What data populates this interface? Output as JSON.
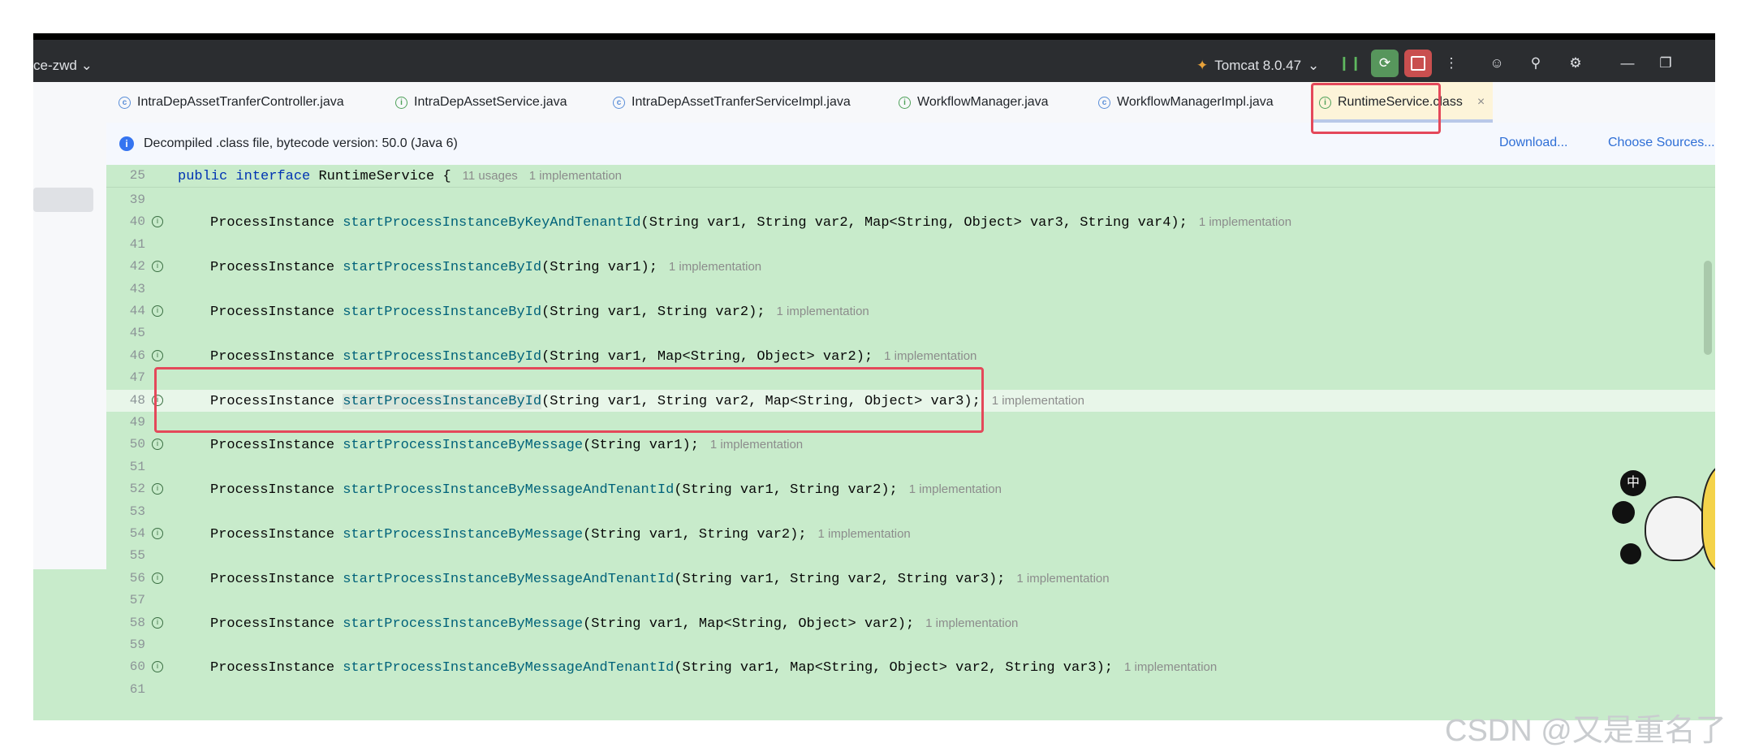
{
  "titlebar": {
    "project": "ce-zwd",
    "run_config": "Tomcat 8.0.47"
  },
  "tabs": [
    {
      "label": "IntraDepAssetTranferController.java",
      "icon": "class-icon"
    },
    {
      "label": "IntraDepAssetService.java",
      "icon": "interface-icon"
    },
    {
      "label": "IntraDepAssetTranferServiceImpl.java",
      "icon": "class-icon"
    },
    {
      "label": "WorkflowManager.java",
      "icon": "interface-icon"
    },
    {
      "label": "WorkflowManagerImpl.java",
      "icon": "class-icon"
    },
    {
      "label": "RuntimeService.class",
      "icon": "interface-icon",
      "active": true
    }
  ],
  "banner": {
    "text": "Decompiled .class file, bytecode version: 50.0 (Java 6)",
    "download": "Download...",
    "choose_sources": "Choose Sources..."
  },
  "sticky": {
    "line": "25",
    "code": "public interface RuntimeService {",
    "usages": "11 usages",
    "impl": "1 implementation"
  },
  "lines": [
    {
      "n": "39"
    },
    {
      "n": "40",
      "ret": "ProcessInstance",
      "method": "startProcessInstanceByKeyAndTenantId",
      "args": "(String var1, String var2, Map<String, Object> var3, String var4);",
      "hint": "1 implementation"
    },
    {
      "n": "41"
    },
    {
      "n": "42",
      "ret": "ProcessInstance",
      "method": "startProcessInstanceById",
      "args": "(String var1);",
      "hint": "1 implementation"
    },
    {
      "n": "43"
    },
    {
      "n": "44",
      "ret": "ProcessInstance",
      "method": "startProcessInstanceById",
      "args": "(String var1, String var2);",
      "hint": "1 implementation"
    },
    {
      "n": "45"
    },
    {
      "n": "46",
      "ret": "ProcessInstance",
      "method": "startProcessInstanceById",
      "args": "(String var1, Map<String, Object> var2);",
      "hint": "1 implementation"
    },
    {
      "n": "47"
    },
    {
      "n": "48",
      "ret": "ProcessInstance",
      "method": "startProcessInstanceById",
      "args": "(String var1, String var2, Map<String, Object> var3);",
      "hint": "1 implementation",
      "current": true
    },
    {
      "n": "49"
    },
    {
      "n": "50",
      "ret": "ProcessInstance",
      "method": "startProcessInstanceByMessage",
      "args": "(String var1);",
      "hint": "1 implementation"
    },
    {
      "n": "51"
    },
    {
      "n": "52",
      "ret": "ProcessInstance",
      "method": "startProcessInstanceByMessageAndTenantId",
      "args": "(String var1, String var2);",
      "hint": "1 implementation"
    },
    {
      "n": "53"
    },
    {
      "n": "54",
      "ret": "ProcessInstance",
      "method": "startProcessInstanceByMessage",
      "args": "(String var1, String var2);",
      "hint": "1 implementation"
    },
    {
      "n": "55"
    },
    {
      "n": "56",
      "ret": "ProcessInstance",
      "method": "startProcessInstanceByMessageAndTenantId",
      "args": "(String var1, String var2, String var3);",
      "hint": "1 implementation"
    },
    {
      "n": "57"
    },
    {
      "n": "58",
      "ret": "ProcessInstance",
      "method": "startProcessInstanceByMessage",
      "args": "(String var1, Map<String, Object> var2);",
      "hint": "1 implementation"
    },
    {
      "n": "59"
    },
    {
      "n": "60",
      "ret": "ProcessInstance",
      "method": "startProcessInstanceByMessageAndTenantId",
      "args": "(String var1, Map<String, Object> var2, String var3);",
      "hint": "1 implementation"
    },
    {
      "n": "61"
    }
  ],
  "mascot_text": "中",
  "watermark": "CSDN @又是重名了",
  "colors": {
    "editor_bg": "#c8ebcb",
    "highlight_box": "#e4485a",
    "keyword": "#0033b3",
    "method": "#00627a"
  }
}
